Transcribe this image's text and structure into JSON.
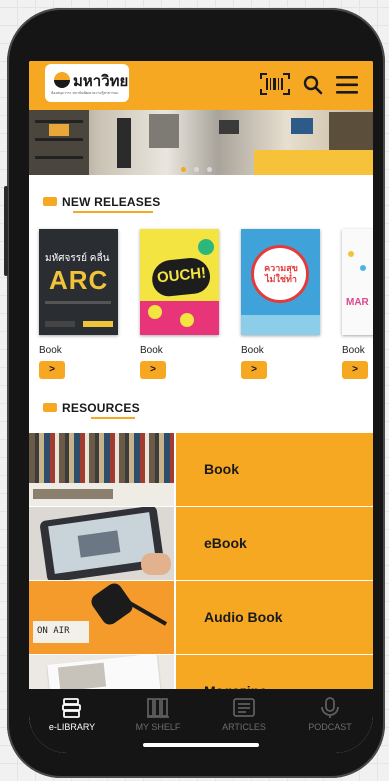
{
  "app": {
    "logo_name": "มหาวิทย",
    "logo_tagline": "ห้องสมุดวาระ สถาบันพัฒนาความรู้สาธารณะ"
  },
  "topbar": {
    "icons": [
      "barcode-scan-icon",
      "search-icon",
      "menu-icon"
    ]
  },
  "banner": {
    "slides": 3,
    "active_index": 0
  },
  "new_releases": {
    "title": "NEW RELEASES",
    "items": [
      {
        "cover_title": "มหัศจรรย์ คลื่น",
        "cover_sub": "ARC",
        "type": "Book",
        "action": ">"
      },
      {
        "cover_title": "OUCH!",
        "cover_sub": "",
        "type": "Book",
        "action": ">"
      },
      {
        "cover_title": "ความสุข ไม่ใช่ทำ",
        "cover_sub": "",
        "type": "Book",
        "action": ">"
      },
      {
        "cover_title": "MAR",
        "cover_sub": "",
        "type": "Book",
        "action": ">"
      }
    ]
  },
  "resources": {
    "title": "RESOURCES",
    "items": [
      {
        "label": "Book"
      },
      {
        "label": "eBook"
      },
      {
        "label": "Audio Book",
        "image_text": "ON AIR"
      },
      {
        "label": "Magazine"
      }
    ]
  },
  "tabbar": {
    "tabs": [
      {
        "label": "e-LIBRARY",
        "icon": "library-icon",
        "active": true
      },
      {
        "label": "MY SHELF",
        "icon": "shelf-icon",
        "active": false
      },
      {
        "label": "ARTICLES",
        "icon": "article-icon",
        "active": false
      },
      {
        "label": "PODCAST",
        "icon": "microphone-icon",
        "active": false
      }
    ]
  },
  "colors": {
    "accent": "#f7a823",
    "dark": "#151515"
  }
}
